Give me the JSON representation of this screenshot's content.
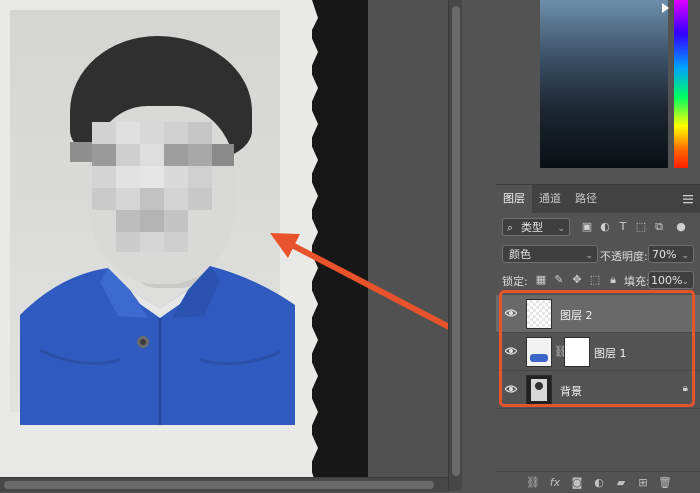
{
  "layers_panel": {
    "tabs": [
      "图层",
      "通道",
      "路径"
    ],
    "filter": {
      "kind_label": "类型"
    },
    "blend": {
      "mode": "颜色",
      "opacity_label": "不透明度:",
      "opacity_value": "70%"
    },
    "lock": {
      "lock_label": "锁定:",
      "fill_label": "填充:",
      "fill_value": "100%"
    },
    "layers": [
      {
        "name": "图层 2",
        "selected": true
      },
      {
        "name": "图层 1",
        "selected": false
      },
      {
        "name": "背景",
        "selected": false,
        "locked": true
      }
    ]
  },
  "colors": {
    "accent_highlight": "#e8532b",
    "jacket_blue": "#2f5bc0",
    "panel_bg": "#535353"
  }
}
